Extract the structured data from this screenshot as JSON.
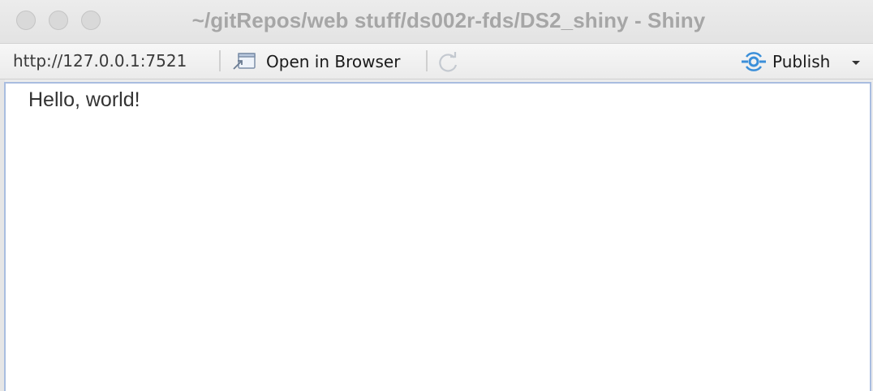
{
  "window": {
    "title": "~/gitRepos/web stuff/ds002r-fds/DS2_shiny - Shiny"
  },
  "toolbar": {
    "url": "http://127.0.0.1:7521",
    "open_in_browser_label": "Open in Browser",
    "publish_label": "Publish",
    "icons": {
      "open_in_browser": "open-in-browser-icon",
      "refresh": "refresh-icon",
      "publish": "publish-icon",
      "dropdown": "chevron-down-icon"
    }
  },
  "content": {
    "text": "Hello, world!"
  },
  "colors": {
    "accent": "#3b8fd9",
    "viewport_border": "#a9bde0"
  }
}
